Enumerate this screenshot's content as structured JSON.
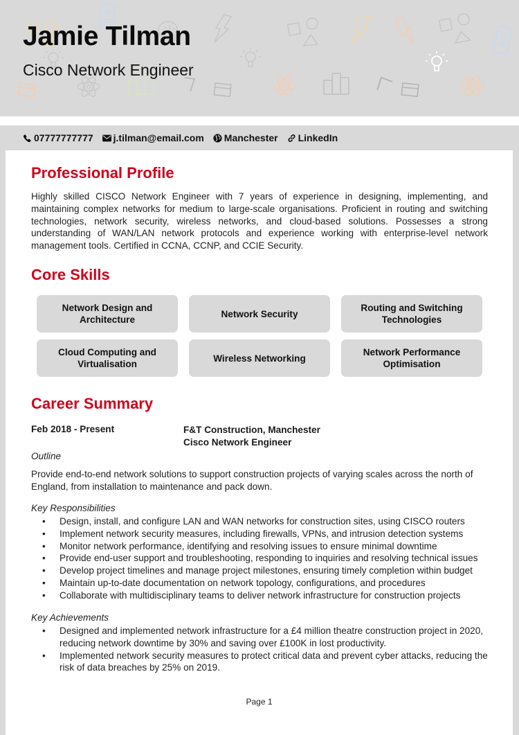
{
  "header": {
    "name": "Jamie Tilman",
    "role": "Cisco Network Engineer"
  },
  "contact": {
    "phone": {
      "icon": "phone-icon",
      "text": "07777777777"
    },
    "email": {
      "icon": "envelope-icon",
      "text": "j.tilman@email.com"
    },
    "location": {
      "icon": "globe-icon",
      "text": "Manchester"
    },
    "linkedin": {
      "icon": "link-icon",
      "text": "LinkedIn"
    }
  },
  "profile": {
    "title": "Professional Profile",
    "text": "Highly skilled CISCO Network Engineer with 7 years of experience in designing, implementing, and maintaining complex networks for medium to large-scale organisations. Proficient in routing and switching technologies, network security, wireless networks, and cloud-based solutions. Possesses a strong understanding of WAN/LAN network protocols and experience working with enterprise-level network management tools. Certified in CCNA, CCNP, and CCIE Security."
  },
  "skills": {
    "title": "Core Skills",
    "items": [
      "Network Design and Architecture",
      "Network Security",
      "Routing and Switching Technologies",
      "Cloud Computing and Virtualisation",
      "Wireless Networking",
      "Network Performance Optimisation"
    ]
  },
  "career": {
    "title": "Career Summary",
    "jobs": [
      {
        "dates": "Feb 2018 - Present",
        "company": "F&T Construction, Manchester",
        "position": "Cisco Network Engineer",
        "outline_label": "Outline",
        "outline": "Provide end-to-end network solutions to support construction projects of varying scales across the north of England, from installation to maintenance and pack down.",
        "responsibilities_label": "Key Responsibilities",
        "responsibilities": [
          "Design, install, and configure LAN and WAN networks for construction sites, using CISCO routers",
          "Implement network security measures, including firewalls, VPNs, and intrusion detection systems",
          "Monitor network performance, identifying and resolving issues to ensure minimal downtime",
          "Provide end-user support and troubleshooting, responding to inquiries and resolving technical issues",
          "Develop project timelines and manage project milestones, ensuring timely completion within budget",
          "Maintain up-to-date documentation on network topology, configurations, and procedures",
          "Collaborate with multidisciplinary teams to deliver network infrastructure for construction projects"
        ],
        "achievements_label": "Key Achievements",
        "achievements": [
          "Designed and implemented network infrastructure for a £4 million theatre construction project in 2020, reducing network downtime by 30% and saving over £100K in lost productivity.",
          "Implemented network security measures to protect critical data and prevent cyber attacks, reducing the risk of data breaches by 25% on 2019."
        ]
      }
    ]
  },
  "footer": {
    "page": "Page 1"
  }
}
